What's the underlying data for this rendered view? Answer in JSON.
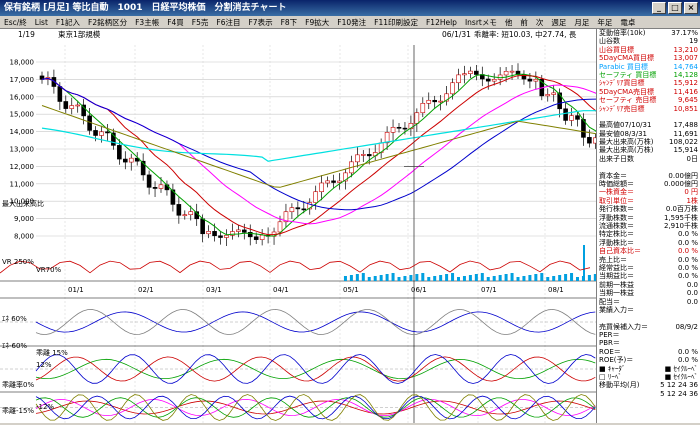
{
  "window": {
    "title": "保有銘柄 [月足] 等比自動　1001　日経平均株価　分割消去チャート"
  },
  "toolbar": [
    "Esc/終",
    "List",
    "F1記入",
    "F2銘柄区分",
    "F3主帳",
    "F4買",
    "F5売",
    "F6注目",
    "F7表示",
    "F8下",
    "F9拡大",
    "F10発注",
    "F11印刷設定",
    "F12Help",
    "Insrtメモ",
    "他",
    "前",
    "次",
    "週足",
    "月足",
    "年足",
    "電卓"
  ],
  "info": {
    "page": "1/19",
    "name": "東京1部規模",
    "date": "06/1/31",
    "detail": "乖離率: 短10.03, 中27.74, 長32.66, 超36.84,"
  },
  "y_axis": [
    "18,000",
    "17,000",
    "16,000",
    "15,000",
    "14,000",
    "13,000",
    "12,000",
    "11,000",
    "10,000",
    "9,000",
    "8,000"
  ],
  "x_axis": [
    "01/1",
    "02/1",
    "03/1",
    "04/1",
    "05/1",
    "06/1",
    "07/1",
    "08/1"
  ],
  "sub_labels": {
    "vol": "最大出来高比",
    "vr": "VR 250%",
    "vr2": "VR70%",
    "rsi1": "ｴﾈ 60%",
    "rsi2": "ｴﾈ-60%",
    "dev1": "乖離 15%",
    "dev2": "乖離率0%",
    "dev3": "乖離-15%",
    "twelve": "12%",
    "twelve2": "-12%",
    "stc": "STC60%"
  },
  "panel": [
    [
      "変動倍率(10k)",
      "37.17%"
    ],
    [
      "山谷数",
      "19"
    ],
    [
      "山谷買目標",
      "13,210"
    ],
    [
      "5DayCMA買目標",
      "13,007"
    ],
    [
      "Parabic 買目標",
      "14,764"
    ],
    [
      "セーフティ 買目標",
      "14,128"
    ],
    [
      "ｼｬﾝﾃﾞﾘｱ買目標",
      "15,912"
    ],
    [
      "5DayCMA売目標",
      "11,416"
    ],
    [
      "セーフティ 売目標",
      "9,645"
    ],
    [
      "ｼｬﾝﾃﾞﾘｱ売目標",
      "10,851"
    ],
    [
      "",
      ""
    ],
    [
      "最高値07/10/31",
      "17,488"
    ],
    [
      "最安値08/3/31",
      "11,691"
    ],
    [
      "最大出来高(万株)",
      "108,022"
    ],
    [
      "最大出来高(万株)",
      "15,914"
    ],
    [
      "出来子日数",
      "0日"
    ],
    [
      "",
      ""
    ],
    [
      "資本金＝",
      "0.00億円"
    ],
    [
      "時価総額＝",
      "0.000億円"
    ],
    [
      "一株資金＝",
      "0 円"
    ],
    [
      "取引単位＝",
      "1株"
    ],
    [
      "発行株数＝",
      "0.0百万株"
    ],
    [
      "浮動株数＝",
      "1,595千株"
    ],
    [
      "流通株数＝",
      "2,910千株"
    ],
    [
      "特定株比＝",
      "0.0 %"
    ],
    [
      "浮動株比＝",
      "0.0 %"
    ],
    [
      "自己資本比＝",
      "0.0 %"
    ],
    [
      "売上比＝",
      "0.0 %"
    ],
    [
      "経常益比＝",
      "0.0 %"
    ],
    [
      "当期益比＝",
      "0.0 %"
    ],
    [
      "前期一株益",
      "0.0"
    ],
    [
      "当期一株益",
      "0.0"
    ],
    [
      "配当＝",
      "0.0"
    ],
    [
      "業績入力＝",
      ""
    ],
    [
      "",
      ""
    ],
    [
      "売買候補入力＝",
      "08/9/2"
    ],
    [
      "PER＝",
      ""
    ],
    [
      "PBR＝",
      ""
    ],
    [
      "ROE＝",
      "0.0 %"
    ],
    [
      "ROE(予)＝",
      "0.0 %"
    ],
    [
      "■ ｷｬｰﾀﾞ",
      "■ ｾｲｸﾙｰﾍﾞ"
    ],
    [
      "□ ﾘｰﾍﾞ",
      "■ ｾｲｸﾙｰﾍﾞ"
    ],
    [
      "移動平均(月)",
      "5 12 24 36"
    ],
    [
      "",
      "5 12 24 36"
    ]
  ]
}
